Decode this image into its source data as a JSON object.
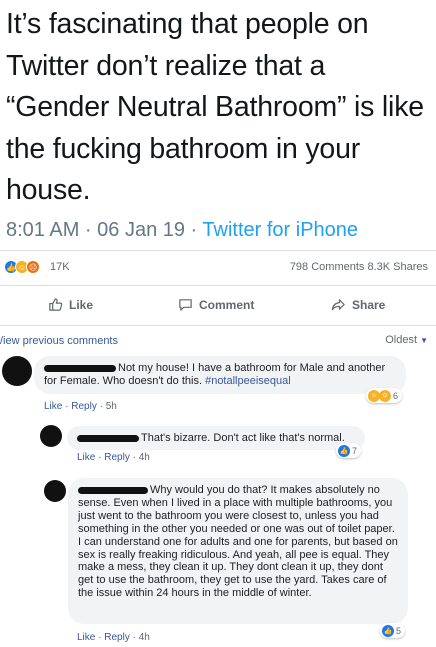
{
  "tweet": {
    "text": "It’s fascinating that people on Twitter don’t realize that a “Gender Neutral Bathroom” is like the fucking bathroom in your house.",
    "time": "8:01 AM · 06 Jan 19 · ",
    "source": "Twitter for iPhone"
  },
  "reactions": {
    "count": "17K",
    "summary": "798 Comments  8.3K Shares"
  },
  "actions": {
    "like": "Like",
    "comment": "Comment",
    "share": "Share"
  },
  "comments_header": {
    "view_previous": "/iew previous comments",
    "sort": "Oldest"
  },
  "comments": [
    {
      "text": "Not my house! I have a bathroom for Male and another for Female. Who doesn't do this. ",
      "hashtag": "#notallpeeisequal",
      "like": "Like",
      "reply": "Reply",
      "time": "5h",
      "reaction_count": "6"
    },
    {
      "text": "That's bizarre. Don't act like that's normal.",
      "like": "Like",
      "reply": "Reply",
      "time": "4h",
      "reaction_count": "7"
    },
    {
      "text": "Why would you do that? It makes absolutely no sense. Even when I lived in a place with multiple bathrooms, you just went to the bathroom you were closest to, unless you had something in the other you needed or one was out of toilet paper. I can understand one for adults and one for parents, but based on sex is really freaking ridiculous. And yeah, all pee is equal. They make a mess, they clean it up. They dont clean it up, they dont get to use the bathroom, they get to use the yard. Takes care of the issue within 24 hours in the middle of winter.",
      "like": "Like",
      "reply": "Reply",
      "time": "4h",
      "reaction_count": "5"
    }
  ],
  "colors": {
    "link": "#385898",
    "twitter_blue": "#1da1f2",
    "like_blue": "#1877f2",
    "bubble": "#f2f3f5"
  }
}
